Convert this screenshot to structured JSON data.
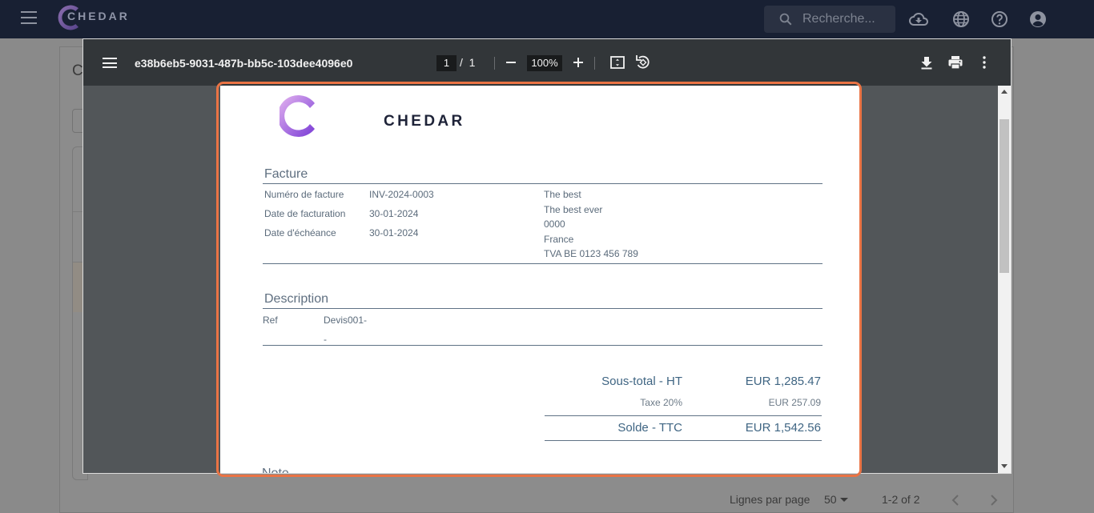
{
  "app": {
    "brand": "CHEDAR",
    "search_placeholder": "Recherche...",
    "icons": [
      "menu-icon",
      "cloud-download-icon",
      "globe-icon",
      "help-icon",
      "account-icon"
    ]
  },
  "background": {
    "heading_initial": "C",
    "filter_initial": "(",
    "pagination": {
      "rows_per_page_label": "Lignes par page",
      "rows_per_page_value": "50",
      "range": "1-2 of 2"
    }
  },
  "viewer": {
    "file_name": "e38b6eb5-9031-487b-bb5c-103dee4096e0",
    "page_current": "1",
    "page_separator": "/",
    "page_total": "1",
    "zoom": "100%"
  },
  "invoice": {
    "brand": "CHEDAR",
    "title": "Facture",
    "fields": [
      {
        "label": "Numéro de facture",
        "value": "INV-2024-0003"
      },
      {
        "label": "Date de facturation",
        "value": "30-01-2024"
      },
      {
        "label": "Date d'échéance",
        "value": "30-01-2024"
      }
    ],
    "client": [
      "The best",
      "The best ever",
      "0000",
      "France",
      "TVA BE 0123 456 789"
    ],
    "description_title": "Description",
    "ref_label": "Ref",
    "ref_value": "Devis001-",
    "ref_extra": "-",
    "subtotal_label": "Sous-total - HT",
    "subtotal_value": "EUR 1,285.47",
    "tax_label": "Taxe 20%",
    "tax_value": "EUR 257.09",
    "total_label": "Solde - TTC",
    "total_value": "EUR 1,542.56",
    "note_title": "Note"
  },
  "colors": {
    "app_bar": "#182033",
    "viewer_toolbar": "#323639",
    "highlight": "#ea7344",
    "brand_gradient": [
      "#e6b6f0",
      "#7a3cd6"
    ]
  }
}
